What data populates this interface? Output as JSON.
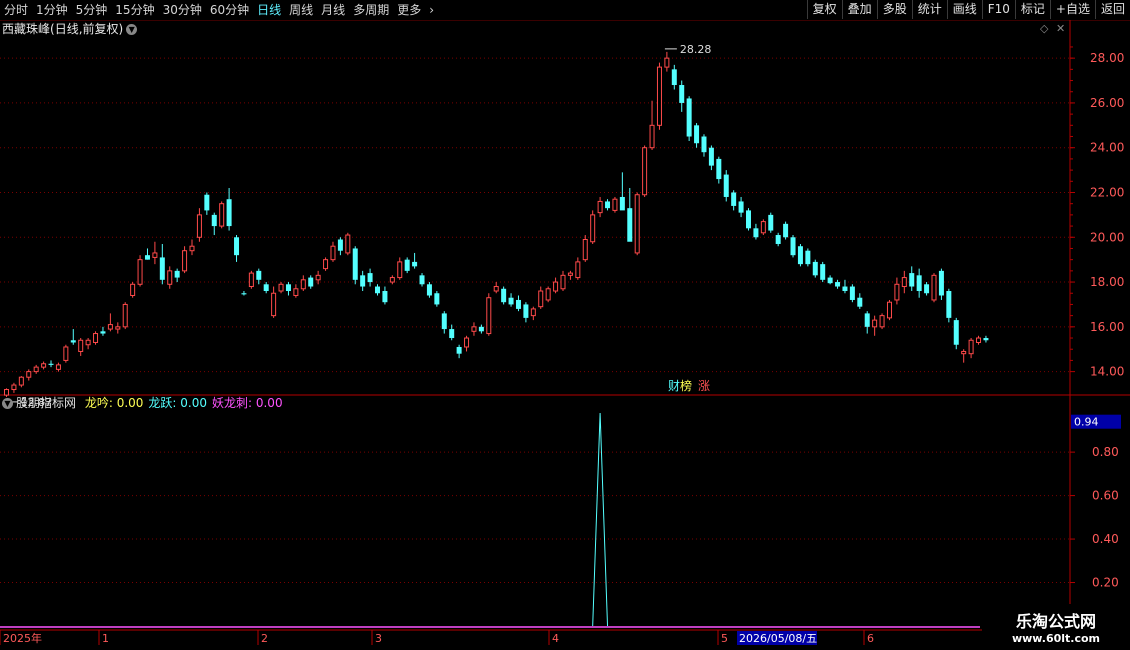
{
  "toolbar": {
    "periods": [
      "分时",
      "1分钟",
      "5分钟",
      "15分钟",
      "30分钟",
      "60分钟",
      "日线",
      "周线",
      "月线",
      "多周期",
      "更多"
    ],
    "active_period": "日线",
    "right_buttons": [
      "复权",
      "叠加",
      "多股",
      "统计",
      "画线",
      "F10",
      "标记",
      "+自选",
      "返回"
    ]
  },
  "stock": {
    "name": "西藏珠峰",
    "mode": "(日线,前复权)"
  },
  "indicator": {
    "name": "股朋指标网",
    "items": [
      {
        "label": "龙吟:",
        "value": "0.00",
        "color": "#ffff54"
      },
      {
        "label": "龙跃:",
        "value": "0.00",
        "color": "#54ffff"
      },
      {
        "label": "妖龙刺:",
        "value": "0.00",
        "color": "#ff54ff"
      }
    ]
  },
  "badges": [
    {
      "text": "财",
      "color": "#54ffff"
    },
    {
      "text": "榜",
      "color": "#ffff54"
    },
    {
      "text": "涨",
      "color": "#ff5454"
    }
  ],
  "watermark": {
    "line1": "乐淘公式网",
    "line2": "www.60lt.com"
  },
  "colors": {
    "up": "#ff4a4a",
    "down": "#54ffff",
    "grid": "#7a0000",
    "axis": "#b40000",
    "label": "#ff5a5a",
    "indicator_line": "#54ffff",
    "highlight_box": "#0000a8"
  },
  "chart_data": [
    {
      "type": "candlestick",
      "ylim": [
        13.0,
        28.9
      ],
      "yticks": [
        "14.00",
        "16.00",
        "18.00",
        "20.00",
        "22.00",
        "24.00",
        "26.00",
        "28.00"
      ],
      "x_tick_labels": [
        "2025年",
        "1",
        "2",
        "3",
        "4",
        "5",
        "2026/05/08/五",
        "6"
      ],
      "annotations": {
        "high": "28.28",
        "low": "12.87"
      },
      "candles": [
        {
          "o": 12.95,
          "h": 13.25,
          "l": 12.87,
          "c": 13.2
        },
        {
          "o": 13.2,
          "h": 13.5,
          "l": 13.05,
          "c": 13.4
        },
        {
          "o": 13.4,
          "h": 13.8,
          "l": 13.3,
          "c": 13.75
        },
        {
          "o": 13.75,
          "h": 14.1,
          "l": 13.6,
          "c": 14.0
        },
        {
          "o": 14.0,
          "h": 14.3,
          "l": 13.9,
          "c": 14.2
        },
        {
          "o": 14.2,
          "h": 14.45,
          "l": 14.1,
          "c": 14.35
        },
        {
          "o": 14.35,
          "h": 14.5,
          "l": 14.2,
          "c": 14.3
        },
        {
          "o": 14.1,
          "h": 14.4,
          "l": 14.0,
          "c": 14.3
        },
        {
          "o": 14.5,
          "h": 15.2,
          "l": 14.4,
          "c": 15.1
        },
        {
          "o": 15.4,
          "h": 15.9,
          "l": 15.2,
          "c": 15.3
        },
        {
          "o": 14.9,
          "h": 15.5,
          "l": 14.7,
          "c": 15.4
        },
        {
          "o": 15.2,
          "h": 15.5,
          "l": 15.0,
          "c": 15.4
        },
        {
          "o": 15.3,
          "h": 15.8,
          "l": 15.2,
          "c": 15.7
        },
        {
          "o": 15.8,
          "h": 16.0,
          "l": 15.6,
          "c": 15.7
        },
        {
          "o": 15.9,
          "h": 16.6,
          "l": 15.8,
          "c": 16.1
        },
        {
          "o": 15.9,
          "h": 16.2,
          "l": 15.7,
          "c": 16.0
        },
        {
          "o": 16.0,
          "h": 17.1,
          "l": 15.9,
          "c": 17.0
        },
        {
          "o": 17.4,
          "h": 18.0,
          "l": 17.3,
          "c": 17.9
        },
        {
          "o": 17.9,
          "h": 19.2,
          "l": 17.8,
          "c": 19.0
        },
        {
          "o": 19.2,
          "h": 19.5,
          "l": 19.0,
          "c": 19.0
        },
        {
          "o": 19.1,
          "h": 19.8,
          "l": 18.8,
          "c": 19.3
        },
        {
          "o": 19.1,
          "h": 19.7,
          "l": 17.9,
          "c": 18.1
        },
        {
          "o": 17.9,
          "h": 18.7,
          "l": 17.7,
          "c": 18.5
        },
        {
          "o": 18.5,
          "h": 18.6,
          "l": 18.0,
          "c": 18.2
        },
        {
          "o": 18.5,
          "h": 19.6,
          "l": 18.4,
          "c": 19.4
        },
        {
          "o": 19.4,
          "h": 19.9,
          "l": 19.2,
          "c": 19.6
        },
        {
          "o": 20.0,
          "h": 21.3,
          "l": 19.8,
          "c": 21.0
        },
        {
          "o": 21.9,
          "h": 22.0,
          "l": 21.0,
          "c": 21.2
        },
        {
          "o": 21.0,
          "h": 21.1,
          "l": 20.1,
          "c": 20.5
        },
        {
          "o": 20.5,
          "h": 21.6,
          "l": 20.4,
          "c": 21.5
        },
        {
          "o": 21.7,
          "h": 22.2,
          "l": 20.3,
          "c": 20.5
        },
        {
          "o": 20.0,
          "h": 20.1,
          "l": 18.9,
          "c": 19.2
        },
        {
          "o": 17.5,
          "h": 17.6,
          "l": 17.4,
          "c": 17.45
        },
        {
          "o": 17.8,
          "h": 18.5,
          "l": 17.7,
          "c": 18.4
        },
        {
          "o": 18.5,
          "h": 18.6,
          "l": 17.9,
          "c": 18.1
        },
        {
          "o": 17.9,
          "h": 18.0,
          "l": 17.5,
          "c": 17.6
        },
        {
          "o": 16.5,
          "h": 17.8,
          "l": 16.4,
          "c": 17.5
        },
        {
          "o": 17.6,
          "h": 18.0,
          "l": 17.5,
          "c": 17.9
        },
        {
          "o": 17.9,
          "h": 18.0,
          "l": 17.4,
          "c": 17.6
        },
        {
          "o": 17.4,
          "h": 17.9,
          "l": 17.3,
          "c": 17.7
        },
        {
          "o": 17.7,
          "h": 18.3,
          "l": 17.6,
          "c": 18.1
        },
        {
          "o": 18.2,
          "h": 18.3,
          "l": 17.7,
          "c": 17.8
        },
        {
          "o": 18.1,
          "h": 18.5,
          "l": 17.9,
          "c": 18.3
        },
        {
          "o": 18.6,
          "h": 19.1,
          "l": 18.5,
          "c": 19.0
        },
        {
          "o": 19.0,
          "h": 19.8,
          "l": 18.9,
          "c": 19.6
        },
        {
          "o": 19.9,
          "h": 20.0,
          "l": 19.2,
          "c": 19.4
        },
        {
          "o": 19.3,
          "h": 20.2,
          "l": 19.2,
          "c": 20.1
        },
        {
          "o": 19.5,
          "h": 19.6,
          "l": 17.9,
          "c": 18.1
        },
        {
          "o": 18.3,
          "h": 18.5,
          "l": 17.6,
          "c": 17.8
        },
        {
          "o": 18.4,
          "h": 18.6,
          "l": 17.8,
          "c": 18.0
        },
        {
          "o": 17.8,
          "h": 17.9,
          "l": 17.4,
          "c": 17.5
        },
        {
          "o": 17.6,
          "h": 17.8,
          "l": 17.0,
          "c": 17.1
        },
        {
          "o": 18.0,
          "h": 18.3,
          "l": 17.9,
          "c": 18.2
        },
        {
          "o": 18.2,
          "h": 19.1,
          "l": 18.1,
          "c": 18.9
        },
        {
          "o": 19.0,
          "h": 19.1,
          "l": 18.4,
          "c": 18.5
        },
        {
          "o": 18.9,
          "h": 19.3,
          "l": 18.6,
          "c": 18.7
        },
        {
          "o": 18.3,
          "h": 18.4,
          "l": 17.8,
          "c": 17.9
        },
        {
          "o": 17.9,
          "h": 18.0,
          "l": 17.3,
          "c": 17.4
        },
        {
          "o": 17.5,
          "h": 17.6,
          "l": 16.9,
          "c": 17.0
        },
        {
          "o": 16.6,
          "h": 16.7,
          "l": 15.7,
          "c": 15.9
        },
        {
          "o": 15.9,
          "h": 16.1,
          "l": 15.4,
          "c": 15.5
        },
        {
          "o": 15.1,
          "h": 15.2,
          "l": 14.6,
          "c": 14.8
        },
        {
          "o": 15.1,
          "h": 15.6,
          "l": 14.9,
          "c": 15.5
        },
        {
          "o": 15.8,
          "h": 16.2,
          "l": 15.6,
          "c": 16.0
        },
        {
          "o": 16.0,
          "h": 16.1,
          "l": 15.7,
          "c": 15.8
        },
        {
          "o": 15.7,
          "h": 17.5,
          "l": 15.6,
          "c": 17.3
        },
        {
          "o": 17.6,
          "h": 18.0,
          "l": 17.5,
          "c": 17.8
        },
        {
          "o": 17.7,
          "h": 17.8,
          "l": 17.0,
          "c": 17.1
        },
        {
          "o": 17.3,
          "h": 17.5,
          "l": 16.9,
          "c": 17.0
        },
        {
          "o": 17.2,
          "h": 17.4,
          "l": 16.7,
          "c": 16.8
        },
        {
          "o": 17.0,
          "h": 17.1,
          "l": 16.2,
          "c": 16.4
        },
        {
          "o": 16.5,
          "h": 16.9,
          "l": 16.3,
          "c": 16.8
        },
        {
          "o": 16.9,
          "h": 17.8,
          "l": 16.8,
          "c": 17.6
        },
        {
          "o": 17.2,
          "h": 17.8,
          "l": 17.1,
          "c": 17.7
        },
        {
          "o": 17.6,
          "h": 18.2,
          "l": 17.5,
          "c": 18.0
        },
        {
          "o": 17.7,
          "h": 18.5,
          "l": 17.6,
          "c": 18.3
        },
        {
          "o": 18.3,
          "h": 18.5,
          "l": 18.1,
          "c": 18.4
        },
        {
          "o": 18.2,
          "h": 19.1,
          "l": 18.1,
          "c": 18.9
        },
        {
          "o": 19.0,
          "h": 20.1,
          "l": 18.9,
          "c": 19.9
        },
        {
          "o": 19.8,
          "h": 21.2,
          "l": 19.7,
          "c": 21.0
        },
        {
          "o": 21.1,
          "h": 21.8,
          "l": 20.9,
          "c": 21.6
        },
        {
          "o": 21.6,
          "h": 21.7,
          "l": 21.2,
          "c": 21.3
        },
        {
          "o": 21.2,
          "h": 21.8,
          "l": 21.1,
          "c": 21.7
        },
        {
          "o": 21.8,
          "h": 22.9,
          "l": 21.7,
          "c": 21.2
        },
        {
          "o": 21.3,
          "h": 22.2,
          "l": 21.0,
          "c": 19.8
        },
        {
          "o": 19.3,
          "h": 22.0,
          "l": 19.2,
          "c": 21.9
        },
        {
          "o": 21.9,
          "h": 24.1,
          "l": 21.8,
          "c": 24.0
        },
        {
          "o": 24.0,
          "h": 26.1,
          "l": 23.9,
          "c": 25.0
        },
        {
          "o": 25.0,
          "h": 27.8,
          "l": 24.8,
          "c": 27.6
        },
        {
          "o": 27.6,
          "h": 28.28,
          "l": 27.4,
          "c": 28.0
        },
        {
          "o": 27.5,
          "h": 27.7,
          "l": 26.6,
          "c": 26.8
        },
        {
          "o": 26.8,
          "h": 27.0,
          "l": 25.6,
          "c": 26.0
        },
        {
          "o": 26.2,
          "h": 26.3,
          "l": 24.3,
          "c": 24.5
        },
        {
          "o": 25.0,
          "h": 25.1,
          "l": 24.0,
          "c": 24.2
        },
        {
          "o": 24.5,
          "h": 24.6,
          "l": 23.6,
          "c": 23.8
        },
        {
          "o": 24.0,
          "h": 24.1,
          "l": 23.0,
          "c": 23.2
        },
        {
          "o": 23.5,
          "h": 23.6,
          "l": 22.4,
          "c": 22.6
        },
        {
          "o": 22.8,
          "h": 23.0,
          "l": 21.6,
          "c": 21.8
        },
        {
          "o": 22.0,
          "h": 22.1,
          "l": 21.2,
          "c": 21.4
        },
        {
          "o": 21.6,
          "h": 21.8,
          "l": 20.9,
          "c": 21.1
        },
        {
          "o": 21.2,
          "h": 21.3,
          "l": 20.3,
          "c": 20.4
        },
        {
          "o": 20.4,
          "h": 20.6,
          "l": 19.9,
          "c": 20.0
        },
        {
          "o": 20.2,
          "h": 20.8,
          "l": 20.1,
          "c": 20.7
        },
        {
          "o": 21.0,
          "h": 21.1,
          "l": 20.2,
          "c": 20.3
        },
        {
          "o": 20.1,
          "h": 20.2,
          "l": 19.6,
          "c": 19.7
        },
        {
          "o": 20.6,
          "h": 20.7,
          "l": 19.9,
          "c": 20.0
        },
        {
          "o": 20.0,
          "h": 20.1,
          "l": 19.1,
          "c": 19.2
        },
        {
          "o": 19.6,
          "h": 19.7,
          "l": 18.7,
          "c": 18.8
        },
        {
          "o": 19.4,
          "h": 19.5,
          "l": 18.7,
          "c": 18.8
        },
        {
          "o": 18.9,
          "h": 19.0,
          "l": 18.2,
          "c": 18.3
        },
        {
          "o": 18.8,
          "h": 18.9,
          "l": 18.0,
          "c": 18.1
        },
        {
          "o": 18.2,
          "h": 18.3,
          "l": 17.9,
          "c": 17.95
        },
        {
          "o": 18.0,
          "h": 18.1,
          "l": 17.7,
          "c": 17.8
        },
        {
          "o": 17.8,
          "h": 18.1,
          "l": 17.5,
          "c": 17.6
        },
        {
          "o": 17.8,
          "h": 17.9,
          "l": 17.1,
          "c": 17.2
        },
        {
          "o": 17.3,
          "h": 17.5,
          "l": 16.8,
          "c": 16.9
        },
        {
          "o": 16.6,
          "h": 16.7,
          "l": 15.7,
          "c": 16.0
        },
        {
          "o": 16.0,
          "h": 16.5,
          "l": 15.6,
          "c": 16.3
        },
        {
          "o": 16.0,
          "h": 16.6,
          "l": 15.9,
          "c": 16.5
        },
        {
          "o": 16.4,
          "h": 17.2,
          "l": 16.3,
          "c": 17.1
        },
        {
          "o": 17.2,
          "h": 18.2,
          "l": 17.0,
          "c": 17.9
        },
        {
          "o": 17.8,
          "h": 18.5,
          "l": 17.5,
          "c": 18.2
        },
        {
          "o": 18.4,
          "h": 18.7,
          "l": 17.6,
          "c": 17.8
        },
        {
          "o": 18.3,
          "h": 18.6,
          "l": 17.3,
          "c": 17.6
        },
        {
          "o": 17.9,
          "h": 18.0,
          "l": 17.4,
          "c": 17.5
        },
        {
          "o": 17.2,
          "h": 18.4,
          "l": 17.1,
          "c": 18.3
        },
        {
          "o": 18.5,
          "h": 18.6,
          "l": 17.2,
          "c": 17.4
        },
        {
          "o": 17.6,
          "h": 17.7,
          "l": 16.2,
          "c": 16.4
        },
        {
          "o": 16.3,
          "h": 16.4,
          "l": 15.0,
          "c": 15.2
        },
        {
          "o": 14.8,
          "h": 15.0,
          "l": 14.4,
          "c": 14.9
        },
        {
          "o": 14.8,
          "h": 15.5,
          "l": 14.6,
          "c": 15.4
        },
        {
          "o": 15.3,
          "h": 15.6,
          "l": 15.2,
          "c": 15.5
        },
        {
          "o": 15.5,
          "h": 15.6,
          "l": 15.3,
          "c": 15.4
        }
      ]
    },
    {
      "type": "line",
      "name": "龙跃",
      "ylim": [
        0,
        0.98
      ],
      "yticks": [
        "0.94",
        "0.80",
        "0.60",
        "0.40",
        "0.20"
      ],
      "current_value": "0.94",
      "spike": {
        "index": 80,
        "value": 0.98
      }
    }
  ]
}
